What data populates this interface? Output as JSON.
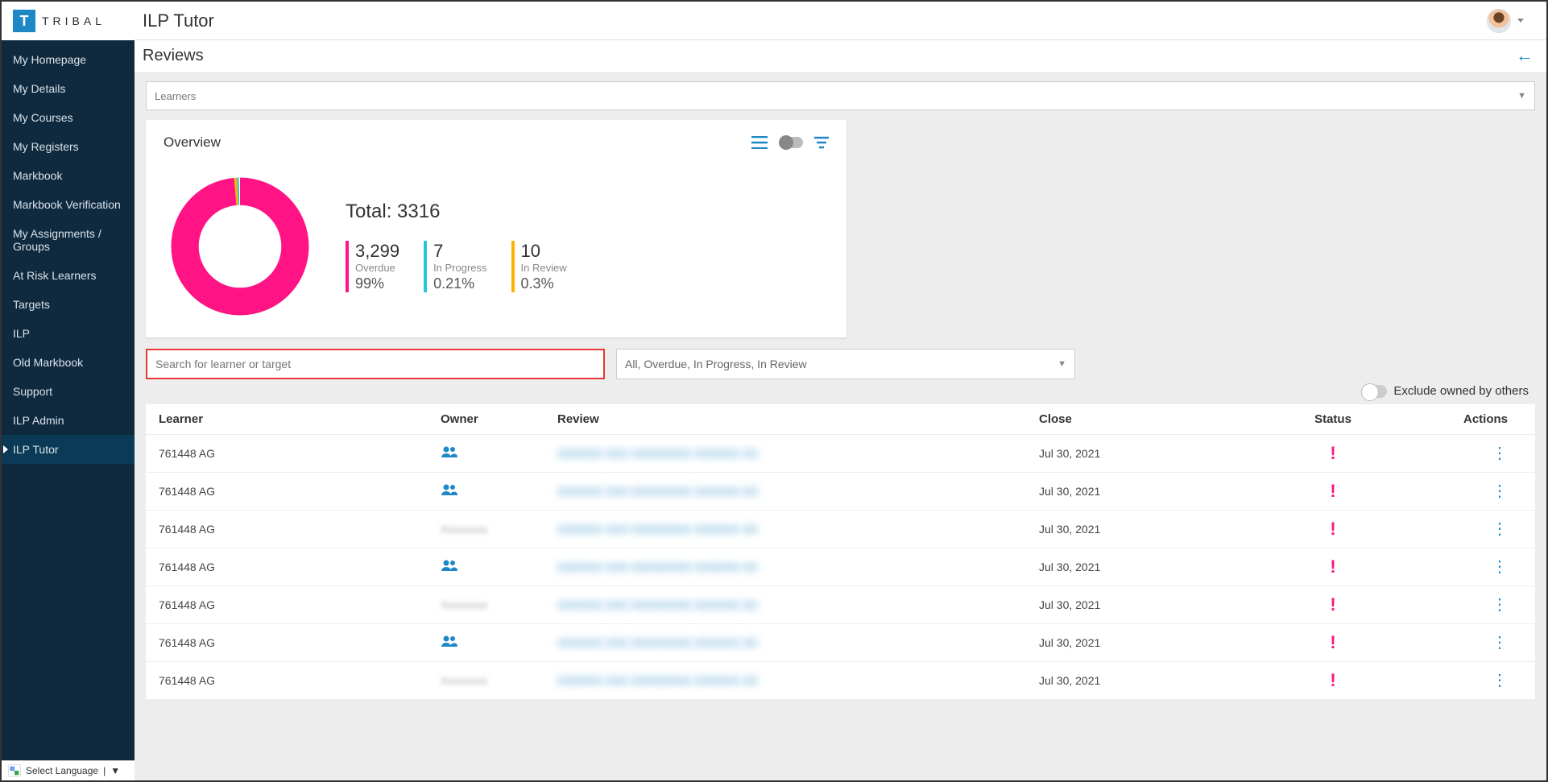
{
  "brand": {
    "logo_letter": "T",
    "logo_text": "TRIBAL"
  },
  "app_title": "ILP Tutor",
  "nav": [
    {
      "label": "My Homepage",
      "active": false
    },
    {
      "label": "My Details",
      "active": false
    },
    {
      "label": "My Courses",
      "active": false
    },
    {
      "label": "My Registers",
      "active": false
    },
    {
      "label": "Markbook",
      "active": false
    },
    {
      "label": "Markbook Verification",
      "active": false
    },
    {
      "label": "My Assignments / Groups",
      "active": false
    },
    {
      "label": "At Risk Learners",
      "active": false
    },
    {
      "label": "Targets",
      "active": false
    },
    {
      "label": "ILP",
      "active": false
    },
    {
      "label": "Old Markbook",
      "active": false
    },
    {
      "label": "Support",
      "active": false
    },
    {
      "label": "ILP Admin",
      "active": false
    },
    {
      "label": "ILP Tutor",
      "active": true
    }
  ],
  "language_selector": "Select Language",
  "subheader": {
    "title": "Reviews"
  },
  "learner_dropdown": "Learners",
  "overview": {
    "title": "Overview",
    "total_label": "Total:",
    "total_value": "3316",
    "stats": {
      "overdue": {
        "count": "3,299",
        "label": "Overdue",
        "pct": "99%"
      },
      "in_progress": {
        "count": "7",
        "label": "In Progress",
        "pct": "0.21%"
      },
      "in_review": {
        "count": "10",
        "label": "In Review",
        "pct": "0.3%"
      }
    }
  },
  "search": {
    "placeholder": "Search for learner or target"
  },
  "status_filter": "All, Overdue, In Progress, In Review",
  "exclude_label": "Exclude owned by others",
  "columns": {
    "learner": "Learner",
    "owner": "Owner",
    "review": "Review",
    "close": "Close",
    "status": "Status",
    "actions": "Actions"
  },
  "rows": [
    {
      "learner": "761448 AG",
      "owner_icon": true,
      "review_blur": "XXXXXX XXX XXXXXXXX XXXXXX XX",
      "close": "Jul 30, 2021"
    },
    {
      "learner": "761448 AG",
      "owner_icon": true,
      "review_blur": "XXXXXX XXX XXXXXXXX XXXXXX XX",
      "close": "Jul 30, 2021"
    },
    {
      "learner": "761448 AG",
      "owner_icon": false,
      "review_blur": "XXXXXX XXX XXXXXXXX XXXXXX XX",
      "close": "Jul 30, 2021"
    },
    {
      "learner": "761448 AG",
      "owner_icon": true,
      "review_blur": "XXXXXX XXX XXXXXXXX XXXXXX XX",
      "close": "Jul 30, 2021"
    },
    {
      "learner": "761448 AG",
      "owner_icon": false,
      "review_blur": "XXXXXX XXX XXXXXXXX XXXXXX XX",
      "close": "Jul 30, 2021"
    },
    {
      "learner": "761448 AG",
      "owner_icon": true,
      "review_blur": "XXXXXX XXX XXXXXXXX XXXXXX XX",
      "close": "Jul 30, 2021"
    },
    {
      "learner": "761448 AG",
      "owner_icon": false,
      "review_blur": "XXXXXX XXX XXXXXXXX XXXXXX XX",
      "close": "Jul 30, 2021"
    }
  ],
  "chart_data": {
    "type": "pie",
    "title": "Reviews by status",
    "series": [
      {
        "name": "Overdue",
        "value": 3299,
        "pct": 99,
        "color": "#ff1385"
      },
      {
        "name": "In Progress",
        "value": 7,
        "pct": 0.21,
        "color": "#26c6da"
      },
      {
        "name": "In Review",
        "value": 10,
        "pct": 0.3,
        "color": "#ffb300"
      }
    ],
    "total": 3316
  }
}
